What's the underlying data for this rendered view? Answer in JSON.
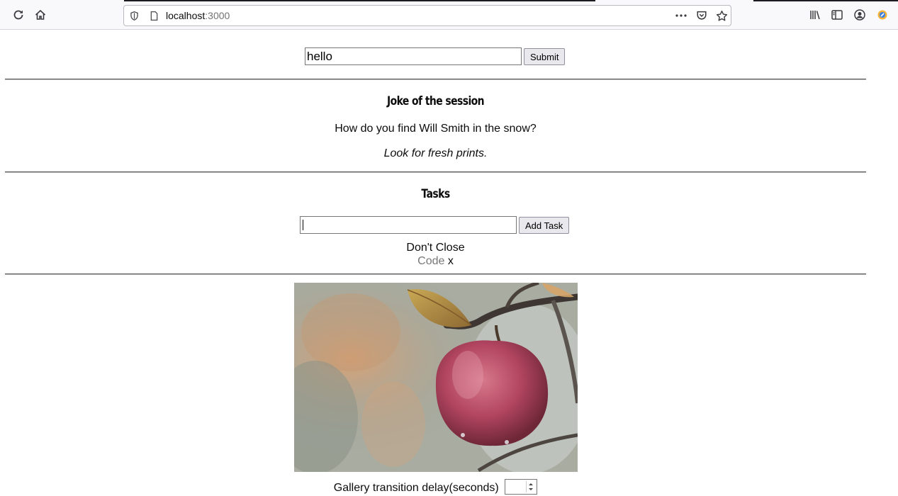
{
  "browser": {
    "url_host": "localhost",
    "url_port": ":3000",
    "toolbar_icons": [
      "reload-icon",
      "home-icon",
      "shield-icon",
      "page-icon",
      "more-icon",
      "pocket-icon",
      "star-icon",
      "library-icon",
      "sidebar-icon",
      "account-icon",
      "extension-icon"
    ]
  },
  "search": {
    "value": "hello",
    "submit_label": "Submit"
  },
  "joke": {
    "heading": "Joke of the session",
    "question": "How do you find Will Smith in the snow?",
    "answer": "Look for fresh prints."
  },
  "tasks": {
    "heading": "Tasks",
    "input_value": "",
    "add_label": "Add Task",
    "items": [
      {
        "title": "Don't Close",
        "category": "Code",
        "remove": "x"
      }
    ]
  },
  "gallery": {
    "image": "apple-on-branch-photo",
    "delay_label": "Gallery transition delay(seconds)",
    "delay_value": ""
  },
  "colors": {
    "divider": "#555555",
    "link_gray": "#777777",
    "button_bg": "#e9e9ed"
  }
}
